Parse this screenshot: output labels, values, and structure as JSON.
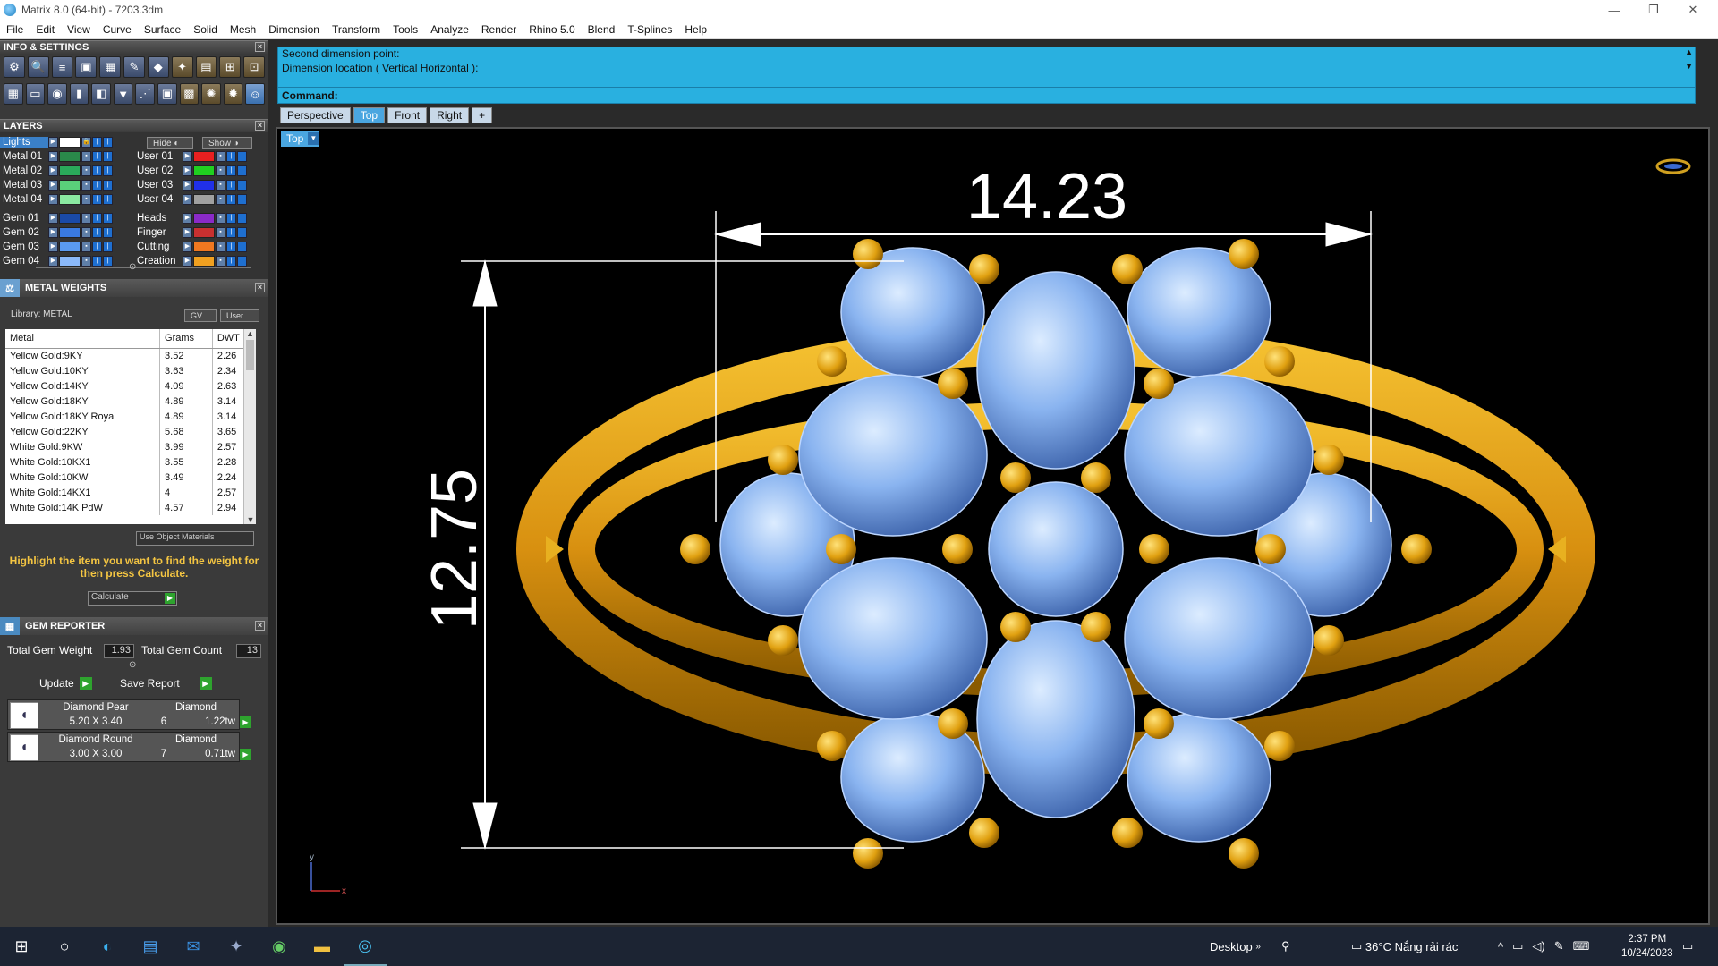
{
  "window": {
    "title": "Matrix 8.0 (64-bit) - 7203.3dm"
  },
  "menu": [
    "File",
    "Edit",
    "View",
    "Curve",
    "Surface",
    "Solid",
    "Mesh",
    "Dimension",
    "Transform",
    "Tools",
    "Analyze",
    "Render",
    "Rhino 5.0",
    "Blend",
    "T-Splines",
    "Help"
  ],
  "info_panel": {
    "title": "INFO & SETTINGS"
  },
  "layers_panel": {
    "title": "LAYERS",
    "hide_label": "Hide",
    "show_label": "Show",
    "lights_label": "Lights",
    "left": [
      {
        "name": "Metal 01",
        "color": "#2a8a4a"
      },
      {
        "name": "Metal 02",
        "color": "#2aaa5a"
      },
      {
        "name": "Metal 03",
        "color": "#5ad07a"
      },
      {
        "name": "Metal 04",
        "color": "#8ae8a0"
      },
      {
        "name": "Gem 01",
        "color": "#1a4aa8"
      },
      {
        "name": "Gem 02",
        "color": "#3a7ae0"
      },
      {
        "name": "Gem 03",
        "color": "#5a9af0"
      },
      {
        "name": "Gem 04",
        "color": "#8ab8f8"
      }
    ],
    "right": [
      {
        "name": "User 01",
        "color": "#e82020"
      },
      {
        "name": "User 02",
        "color": "#20d020"
      },
      {
        "name": "User 03",
        "color": "#2030e8"
      },
      {
        "name": "User 04",
        "color": "#a0a0a0"
      },
      {
        "name": "Heads",
        "color": "#8a2ac8"
      },
      {
        "name": "Finger",
        "color": "#c83030"
      },
      {
        "name": "Cutting",
        "color": "#f07820"
      },
      {
        "name": "Creation",
        "color": "#f0a020"
      }
    ]
  },
  "metal_weights": {
    "title": "METAL WEIGHTS",
    "library_label": "Library: METAL",
    "gv_label": "GV",
    "user_label": "User",
    "columns": [
      "Metal",
      "Grams",
      "DWT"
    ],
    "rows": [
      [
        "Yellow Gold:9KY",
        "3.52",
        "2.26"
      ],
      [
        "Yellow Gold:10KY",
        "3.63",
        "2.34"
      ],
      [
        "Yellow Gold:14KY",
        "4.09",
        "2.63"
      ],
      [
        "Yellow Gold:18KY",
        "4.89",
        "3.14"
      ],
      [
        "Yellow Gold:18KY Royal",
        "4.89",
        "3.14"
      ],
      [
        "Yellow Gold:22KY",
        "5.68",
        "3.65"
      ],
      [
        "White Gold:9KW",
        "3.99",
        "2.57"
      ],
      [
        "White Gold:10KX1",
        "3.55",
        "2.28"
      ],
      [
        "White Gold:10KW",
        "3.49",
        "2.24"
      ],
      [
        "White Gold:14KX1",
        "4",
        "2.57"
      ],
      [
        "White Gold:14K PdW",
        "4.57",
        "2.94"
      ]
    ],
    "use_materials": "Use Object Materials",
    "instruction": "Highlight the item you want to find the weight for then press Calculate.",
    "calculate": "Calculate"
  },
  "gem_reporter": {
    "title": "GEM REPORTER",
    "total_weight_label": "Total Gem Weight",
    "total_weight": "1.93",
    "total_count_label": "Total Gem Count",
    "total_count": "13",
    "update": "Update",
    "save_report": "Save Report",
    "gems": [
      {
        "shape": "Diamond Pear",
        "material": "Diamond",
        "size": "5.20 X 3.40",
        "count": "6",
        "weight": "1.22tw"
      },
      {
        "shape": "Diamond Round",
        "material": "Diamond",
        "size": "3.00 X 3.00",
        "count": "7",
        "weight": "0.71tw"
      }
    ]
  },
  "command": {
    "line1": "Second dimension point:",
    "line2": "Dimension location ( Vertical  Horizontal ):",
    "label": "Command:",
    "value": ""
  },
  "viewport": {
    "tabs": [
      "Perspective",
      "Top",
      "Front",
      "Right",
      "+"
    ],
    "active_tab": "Top",
    "label": "Top",
    "dim_horizontal": "14.23",
    "dim_vertical": "12.75",
    "axis_x": "x",
    "axis_y": "y",
    "colors": {
      "gold": "#e0a010",
      "gem": "#8ab4f0",
      "background": "#000000"
    }
  },
  "taskbar": {
    "desktop": "Desktop",
    "weather": "36°C  Nắng rải rác",
    "time": "2:37 PM",
    "date": "10/24/2023"
  }
}
